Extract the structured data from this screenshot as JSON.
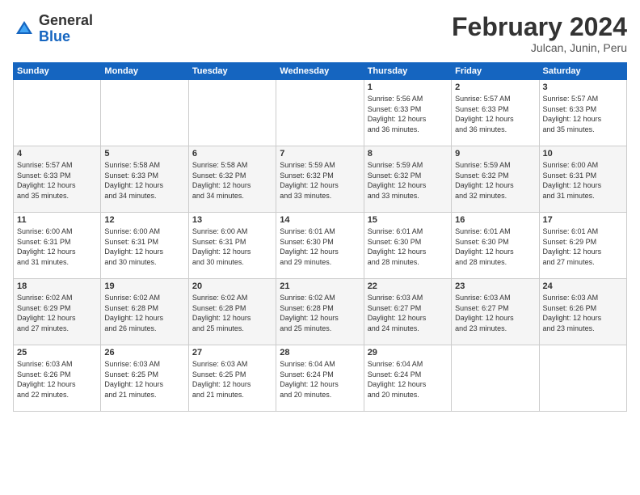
{
  "logo": {
    "general": "General",
    "blue": "Blue"
  },
  "title": "February 2024",
  "location": "Julcan, Junin, Peru",
  "days_header": [
    "Sunday",
    "Monday",
    "Tuesday",
    "Wednesday",
    "Thursday",
    "Friday",
    "Saturday"
  ],
  "weeks": [
    [
      {
        "num": "",
        "info": ""
      },
      {
        "num": "",
        "info": ""
      },
      {
        "num": "",
        "info": ""
      },
      {
        "num": "",
        "info": ""
      },
      {
        "num": "1",
        "info": "Sunrise: 5:56 AM\nSunset: 6:33 PM\nDaylight: 12 hours\nand 36 minutes."
      },
      {
        "num": "2",
        "info": "Sunrise: 5:57 AM\nSunset: 6:33 PM\nDaylight: 12 hours\nand 36 minutes."
      },
      {
        "num": "3",
        "info": "Sunrise: 5:57 AM\nSunset: 6:33 PM\nDaylight: 12 hours\nand 35 minutes."
      }
    ],
    [
      {
        "num": "4",
        "info": "Sunrise: 5:57 AM\nSunset: 6:33 PM\nDaylight: 12 hours\nand 35 minutes."
      },
      {
        "num": "5",
        "info": "Sunrise: 5:58 AM\nSunset: 6:33 PM\nDaylight: 12 hours\nand 34 minutes."
      },
      {
        "num": "6",
        "info": "Sunrise: 5:58 AM\nSunset: 6:32 PM\nDaylight: 12 hours\nand 34 minutes."
      },
      {
        "num": "7",
        "info": "Sunrise: 5:59 AM\nSunset: 6:32 PM\nDaylight: 12 hours\nand 33 minutes."
      },
      {
        "num": "8",
        "info": "Sunrise: 5:59 AM\nSunset: 6:32 PM\nDaylight: 12 hours\nand 33 minutes."
      },
      {
        "num": "9",
        "info": "Sunrise: 5:59 AM\nSunset: 6:32 PM\nDaylight: 12 hours\nand 32 minutes."
      },
      {
        "num": "10",
        "info": "Sunrise: 6:00 AM\nSunset: 6:31 PM\nDaylight: 12 hours\nand 31 minutes."
      }
    ],
    [
      {
        "num": "11",
        "info": "Sunrise: 6:00 AM\nSunset: 6:31 PM\nDaylight: 12 hours\nand 31 minutes."
      },
      {
        "num": "12",
        "info": "Sunrise: 6:00 AM\nSunset: 6:31 PM\nDaylight: 12 hours\nand 30 minutes."
      },
      {
        "num": "13",
        "info": "Sunrise: 6:00 AM\nSunset: 6:31 PM\nDaylight: 12 hours\nand 30 minutes."
      },
      {
        "num": "14",
        "info": "Sunrise: 6:01 AM\nSunset: 6:30 PM\nDaylight: 12 hours\nand 29 minutes."
      },
      {
        "num": "15",
        "info": "Sunrise: 6:01 AM\nSunset: 6:30 PM\nDaylight: 12 hours\nand 28 minutes."
      },
      {
        "num": "16",
        "info": "Sunrise: 6:01 AM\nSunset: 6:30 PM\nDaylight: 12 hours\nand 28 minutes."
      },
      {
        "num": "17",
        "info": "Sunrise: 6:01 AM\nSunset: 6:29 PM\nDaylight: 12 hours\nand 27 minutes."
      }
    ],
    [
      {
        "num": "18",
        "info": "Sunrise: 6:02 AM\nSunset: 6:29 PM\nDaylight: 12 hours\nand 27 minutes."
      },
      {
        "num": "19",
        "info": "Sunrise: 6:02 AM\nSunset: 6:28 PM\nDaylight: 12 hours\nand 26 minutes."
      },
      {
        "num": "20",
        "info": "Sunrise: 6:02 AM\nSunset: 6:28 PM\nDaylight: 12 hours\nand 25 minutes."
      },
      {
        "num": "21",
        "info": "Sunrise: 6:02 AM\nSunset: 6:28 PM\nDaylight: 12 hours\nand 25 minutes."
      },
      {
        "num": "22",
        "info": "Sunrise: 6:03 AM\nSunset: 6:27 PM\nDaylight: 12 hours\nand 24 minutes."
      },
      {
        "num": "23",
        "info": "Sunrise: 6:03 AM\nSunset: 6:27 PM\nDaylight: 12 hours\nand 23 minutes."
      },
      {
        "num": "24",
        "info": "Sunrise: 6:03 AM\nSunset: 6:26 PM\nDaylight: 12 hours\nand 23 minutes."
      }
    ],
    [
      {
        "num": "25",
        "info": "Sunrise: 6:03 AM\nSunset: 6:26 PM\nDaylight: 12 hours\nand 22 minutes."
      },
      {
        "num": "26",
        "info": "Sunrise: 6:03 AM\nSunset: 6:25 PM\nDaylight: 12 hours\nand 21 minutes."
      },
      {
        "num": "27",
        "info": "Sunrise: 6:03 AM\nSunset: 6:25 PM\nDaylight: 12 hours\nand 21 minutes."
      },
      {
        "num": "28",
        "info": "Sunrise: 6:04 AM\nSunset: 6:24 PM\nDaylight: 12 hours\nand 20 minutes."
      },
      {
        "num": "29",
        "info": "Sunrise: 6:04 AM\nSunset: 6:24 PM\nDaylight: 12 hours\nand 20 minutes."
      },
      {
        "num": "",
        "info": ""
      },
      {
        "num": "",
        "info": ""
      }
    ]
  ]
}
